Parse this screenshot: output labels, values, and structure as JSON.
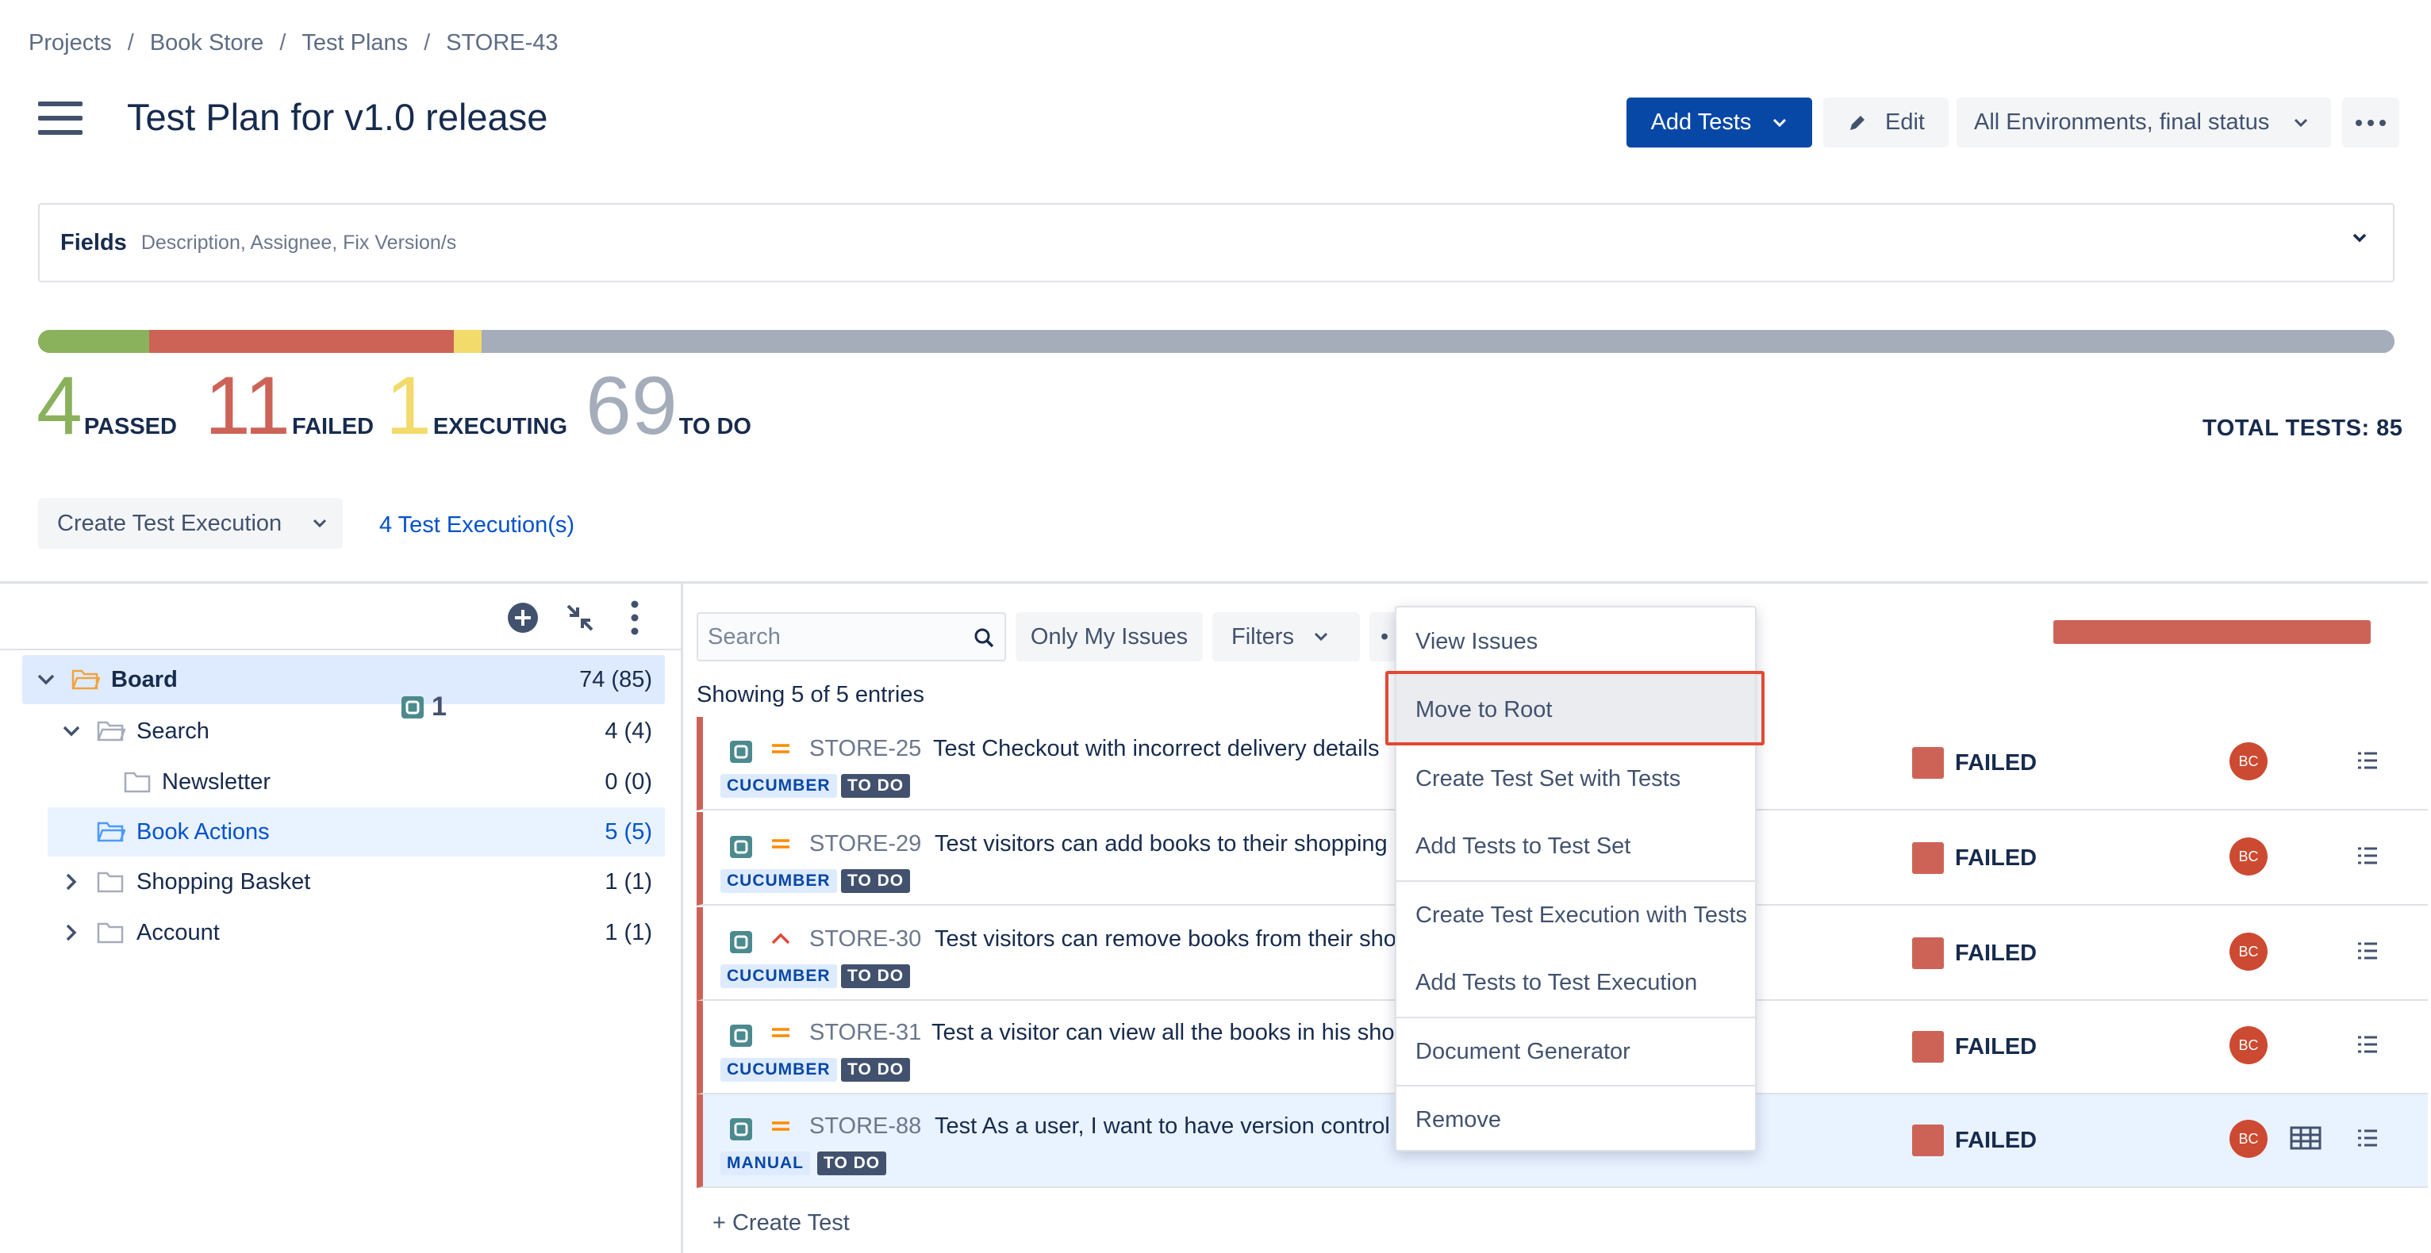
{
  "breadcrumb": [
    "Projects",
    "Book Store",
    "Test Plans",
    "STORE-43"
  ],
  "page_title": "Test Plan for v1.0 release",
  "header": {
    "add_tests": "Add Tests",
    "edit": "Edit",
    "environment": "All Environments, final status"
  },
  "fields": {
    "label": "Fields",
    "sub": "Description, Assignee, Fix Version/s"
  },
  "progress": {
    "colors": {
      "passed": "#8ab15c",
      "failed": "#cd6357",
      "executing": "#f3db6b",
      "todo": "#a5adba"
    }
  },
  "stats": {
    "passed": {
      "num": "4",
      "label": "PASSED"
    },
    "failed": {
      "num": "11",
      "label": "FAILED"
    },
    "executing": {
      "num": "1",
      "label": "EXECUTING"
    },
    "todo": {
      "num": "69",
      "label": "TO DO"
    },
    "total": "TOTAL TESTS: 85"
  },
  "actions": {
    "create_execution": "Create Test Execution",
    "executions_link": "4 Test Execution(s)"
  },
  "tree": {
    "items": [
      {
        "label": "Board",
        "count": "74 (85)"
      },
      {
        "label": "Search",
        "count": "4 (4)"
      },
      {
        "label": "Newsletter",
        "count": "0 (0)"
      },
      {
        "label": "Book Actions",
        "count": "5 (5)"
      },
      {
        "label": "Shopping Basket",
        "count": "1 (1)"
      },
      {
        "label": "Account",
        "count": "1 (1)"
      }
    ],
    "drag_count": "1"
  },
  "list": {
    "search_placeholder": "Search",
    "only_my_issues": "Only My Issues",
    "filters": "Filters",
    "showing": "Showing 5 of 5 entries",
    "create_test": "+ Create Test",
    "rows": [
      {
        "key": "STORE-25",
        "summary": "Test Checkout with incorrect delivery details",
        "type": "CUCUMBER",
        "todo": "TO DO",
        "status": "FAILED",
        "avatar": "BC"
      },
      {
        "key": "STORE-29",
        "summary": "Test visitors can add books to their shopping",
        "type": "CUCUMBER",
        "todo": "TO DO",
        "status": "FAILED",
        "avatar": "BC"
      },
      {
        "key": "STORE-30",
        "summary": "Test visitors can remove books from their sho",
        "type": "CUCUMBER",
        "todo": "TO DO",
        "status": "FAILED",
        "avatar": "BC"
      },
      {
        "key": "STORE-31",
        "summary": "Test a visitor can view all the books in his shop",
        "type": "CUCUMBER",
        "todo": "TO DO",
        "status": "FAILED",
        "avatar": "BC"
      },
      {
        "key": "STORE-88",
        "summary": "Test As a user, I want to have version control f",
        "type": "MANUAL",
        "todo": "TO DO",
        "status": "FAILED",
        "avatar": "BC"
      }
    ]
  },
  "menu": {
    "items": [
      "View Issues",
      "Move to Root",
      "Create Test Set with Tests",
      "Add Tests to Test Set",
      "Create Test Execution with Tests",
      "Add Tests to Test Execution",
      "Document Generator",
      "Remove"
    ]
  }
}
